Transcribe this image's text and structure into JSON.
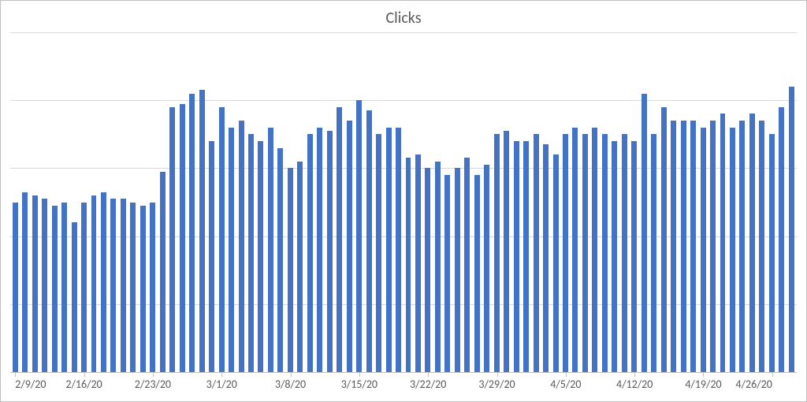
{
  "chart_data": {
    "type": "bar",
    "title": "Clicks",
    "xlabel": "",
    "ylabel": "",
    "ylim": [
      0,
      100
    ],
    "grid_values": [
      20,
      40,
      60,
      80,
      100
    ],
    "categories": [
      "2/9/20",
      "2/10/20",
      "2/11/20",
      "2/12/20",
      "2/13/20",
      "2/14/20",
      "2/15/20",
      "2/16/20",
      "2/17/20",
      "2/18/20",
      "2/19/20",
      "2/20/20",
      "2/21/20",
      "2/22/20",
      "2/23/20",
      "2/24/20",
      "2/25/20",
      "2/26/20",
      "2/27/20",
      "2/28/20",
      "2/29/20",
      "3/1/20",
      "3/2/20",
      "3/3/20",
      "3/4/20",
      "3/5/20",
      "3/6/20",
      "3/7/20",
      "3/8/20",
      "3/9/20",
      "3/10/20",
      "3/11/20",
      "3/12/20",
      "3/13/20",
      "3/14/20",
      "3/15/20",
      "3/16/20",
      "3/17/20",
      "3/18/20",
      "3/19/20",
      "3/20/20",
      "3/21/20",
      "3/22/20",
      "3/23/20",
      "3/24/20",
      "3/25/20",
      "3/26/20",
      "3/27/20",
      "3/28/20",
      "3/29/20",
      "3/30/20",
      "3/31/20",
      "4/1/20",
      "4/2/20",
      "4/3/20",
      "4/4/20",
      "4/5/20",
      "4/6/20",
      "4/7/20",
      "4/8/20",
      "4/9/20",
      "4/10/20",
      "4/11/20",
      "4/12/20",
      "4/13/20",
      "4/14/20",
      "4/15/20",
      "4/16/20",
      "4/17/20",
      "4/18/20",
      "4/19/20",
      "4/20/20",
      "4/21/20",
      "4/22/20",
      "4/23/20",
      "4/24/20",
      "4/25/20",
      "4/26/20",
      "4/27/20",
      "4/28/20"
    ],
    "values": [
      50,
      53,
      52,
      51,
      49,
      50,
      44,
      50,
      52,
      53,
      51,
      51,
      50,
      49,
      50,
      59,
      78,
      79,
      82,
      83,
      68,
      78,
      72,
      74,
      70,
      68,
      72,
      66,
      60,
      62,
      70,
      72,
      71,
      78,
      74,
      80,
      77,
      70,
      72,
      72,
      63,
      64,
      60,
      62,
      58,
      60,
      63,
      58,
      61,
      70,
      71,
      68,
      68,
      70,
      67,
      64,
      70,
      72,
      70,
      72,
      70,
      68,
      70,
      68,
      82,
      70,
      78,
      74,
      74,
      74,
      72,
      74,
      76,
      72,
      74,
      76,
      74,
      70,
      78,
      84
    ],
    "x_tick_labels": [
      "2/9/20",
      "2/16/20",
      "2/23/20",
      "3/1/20",
      "3/8/20",
      "3/15/20",
      "3/22/20",
      "3/29/20",
      "4/5/20",
      "4/12/20",
      "4/19/20",
      "4/26/20"
    ],
    "bar_color": "#4472c4"
  }
}
